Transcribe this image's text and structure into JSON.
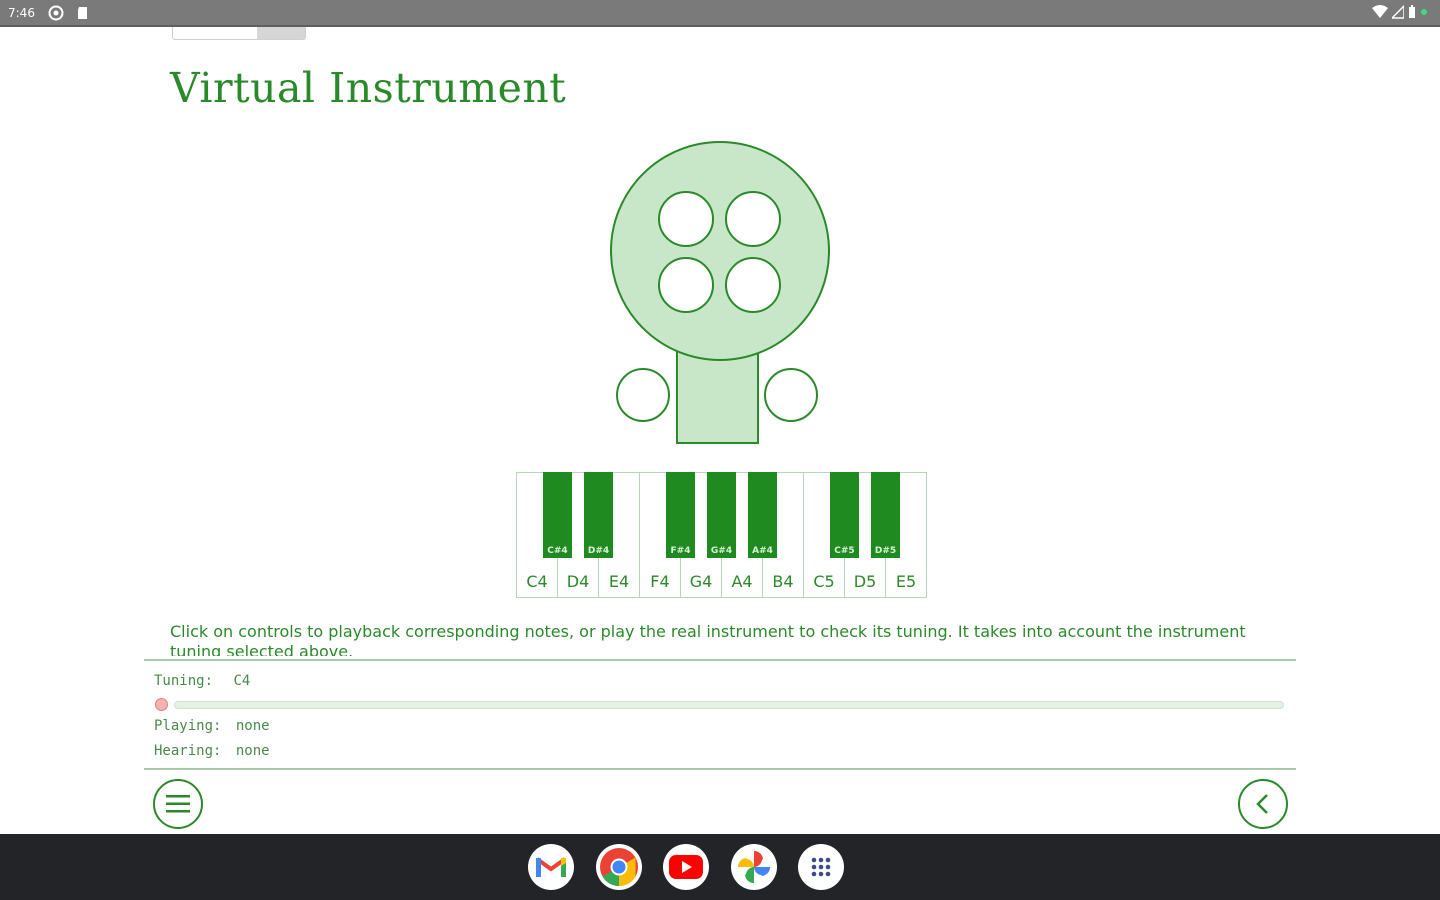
{
  "status_bar": {
    "time": "7:46"
  },
  "page": {
    "title": "Virtual Instrument",
    "description": "Click on controls to playback corresponding notes, or play the real instrument to check its tuning. It takes into account the instrument tuning selected above."
  },
  "keyboard": {
    "white_keys": [
      "C4",
      "D4",
      "E4",
      "F4",
      "G4",
      "A4",
      "B4",
      "C5",
      "D5",
      "E5"
    ],
    "black_keys": [
      "C#4",
      "D#4",
      "F#4",
      "G#4",
      "A#4",
      "C#5",
      "D#5"
    ]
  },
  "panel": {
    "tuning_label": "Tuning:",
    "tuning_value": "C4",
    "playing_label": "Playing:",
    "playing_value": "none",
    "hearing_label": "Hearing:",
    "hearing_value": "none",
    "slider_value": 0
  },
  "taskbar": {
    "apps": [
      "gmail-icon",
      "chrome-icon",
      "youtube-icon",
      "photos-icon",
      "app-launcher-icon"
    ]
  },
  "colors": {
    "accent": "#2a8a2a",
    "instrument_fill": "#c8e6c8",
    "black_key": "#1f8a1f",
    "slider_thumb": "#f4b2b2"
  }
}
